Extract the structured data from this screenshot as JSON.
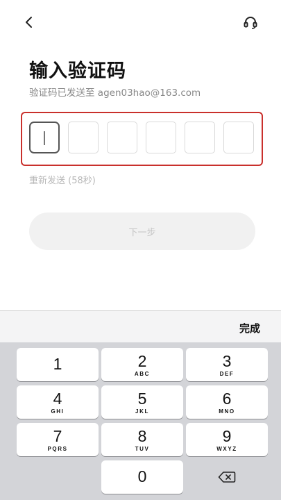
{
  "header": {
    "back_icon": "chevron-left-icon",
    "support_icon": "headset-icon"
  },
  "main": {
    "title": "输入验证码",
    "subtitle": "验证码已发送至 agen03hao@163.com",
    "code_digits": [
      "",
      "",
      "",
      "",
      "",
      ""
    ],
    "resend_label": "重新发送 (58秒)",
    "next_label": "下一步"
  },
  "keyboard": {
    "done_label": "完成",
    "keys": [
      {
        "num": "1",
        "letters": ""
      },
      {
        "num": "2",
        "letters": "ABC"
      },
      {
        "num": "3",
        "letters": "DEF"
      },
      {
        "num": "4",
        "letters": "GHI"
      },
      {
        "num": "5",
        "letters": "JKL"
      },
      {
        "num": "6",
        "letters": "MNO"
      },
      {
        "num": "7",
        "letters": "PQRS"
      },
      {
        "num": "8",
        "letters": "TUV"
      },
      {
        "num": "9",
        "letters": "WXYZ"
      },
      {
        "num": "0",
        "letters": ""
      }
    ],
    "delete_icon": "backspace-icon"
  },
  "colors": {
    "highlight_border": "#c9302c",
    "keyboard_bg": "#d3d4d8",
    "disabled_button_bg": "#f1f1f1"
  }
}
